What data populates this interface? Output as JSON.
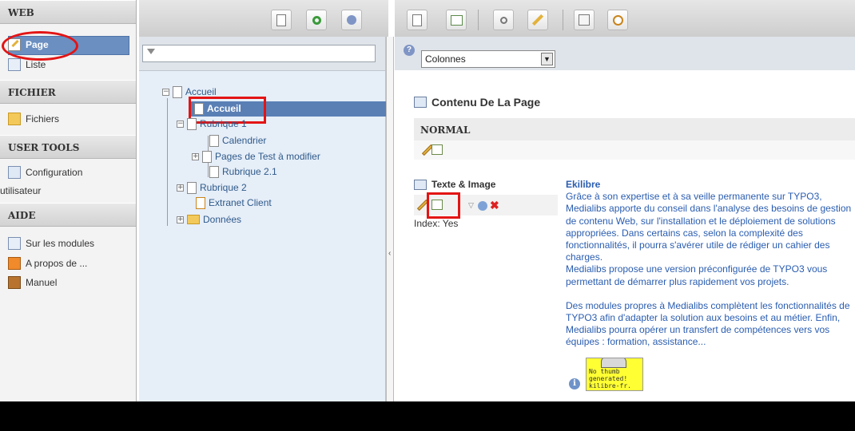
{
  "module_menu": {
    "sections": [
      {
        "title": "WEB",
        "items": [
          {
            "label": "Page",
            "icon": "page-icon"
          },
          {
            "label": "Liste",
            "icon": "list-icon"
          }
        ]
      },
      {
        "title": "FICHIER",
        "items": [
          {
            "label": "Fichiers",
            "icon": "files-icon"
          }
        ]
      },
      {
        "title": "USER TOOLS",
        "items": [
          {
            "label": "Configuration",
            "label2": "utilisateur",
            "icon": "user-config-icon"
          }
        ]
      },
      {
        "title": "AIDE",
        "items": [
          {
            "label": "Sur les modules",
            "icon": "modules-help-icon"
          },
          {
            "label": "A propos de ...",
            "icon": "about-icon"
          },
          {
            "label": "Manuel",
            "icon": "manual-icon"
          }
        ]
      }
    ],
    "selected": "Page"
  },
  "tree": {
    "items": [
      {
        "label": "Accueil",
        "level": 0
      },
      {
        "label": "Accueil",
        "level": 1,
        "selected": true
      },
      {
        "label": "Rubrique 1",
        "level": 1
      },
      {
        "label": "Calendrier",
        "level": 2
      },
      {
        "label": "Pages de Test à modifier",
        "level": 2
      },
      {
        "label": "Rubrique 2.1",
        "level": 2
      },
      {
        "label": "Rubrique 2",
        "level": 1
      },
      {
        "label": "Extranet Client",
        "level": 1
      },
      {
        "label": "Données",
        "level": 1
      }
    ]
  },
  "content": {
    "columns_select": "Colonnes",
    "page_title": "Contenu De La Page",
    "column_header": "NORMAL",
    "element": {
      "type_label": "Texte & Image",
      "index_label": "Index: Yes",
      "title": "Ekilibre",
      "paragraphs": [
        "Grâce à son expertise et à sa veille permanente sur TYPO3, Medialibs apporte du conseil dans l'analyse des besoins de gestion de contenu Web, sur l'installation et le déploiement de solutions appropriées. Dans certains cas, selon la complexité des fonctionnalités, il pourra s'avérer utile de rédiger un cahier des charges.",
        "Medialibs propose une version préconfigurée de TYPO3 vous permettant de démarrer plus rapidement vos projets.",
        "Des modules propres à Medialibs complètent les fonctionnalités de TYPO3 afin d'adapter la solution aux besoins et au métier. Enfin, Medialibs pourra opérer un transfert de compétences vers vos équipes : formation, assistance..."
      ],
      "thumbnail_text": "No thumb generated! kilibre-fr."
    }
  },
  "colors": {
    "highlight_red": "#e31414",
    "selection_blue": "#5a7fb5",
    "link_blue": "#2a5db0",
    "tree_bg": "#e6eef8"
  }
}
